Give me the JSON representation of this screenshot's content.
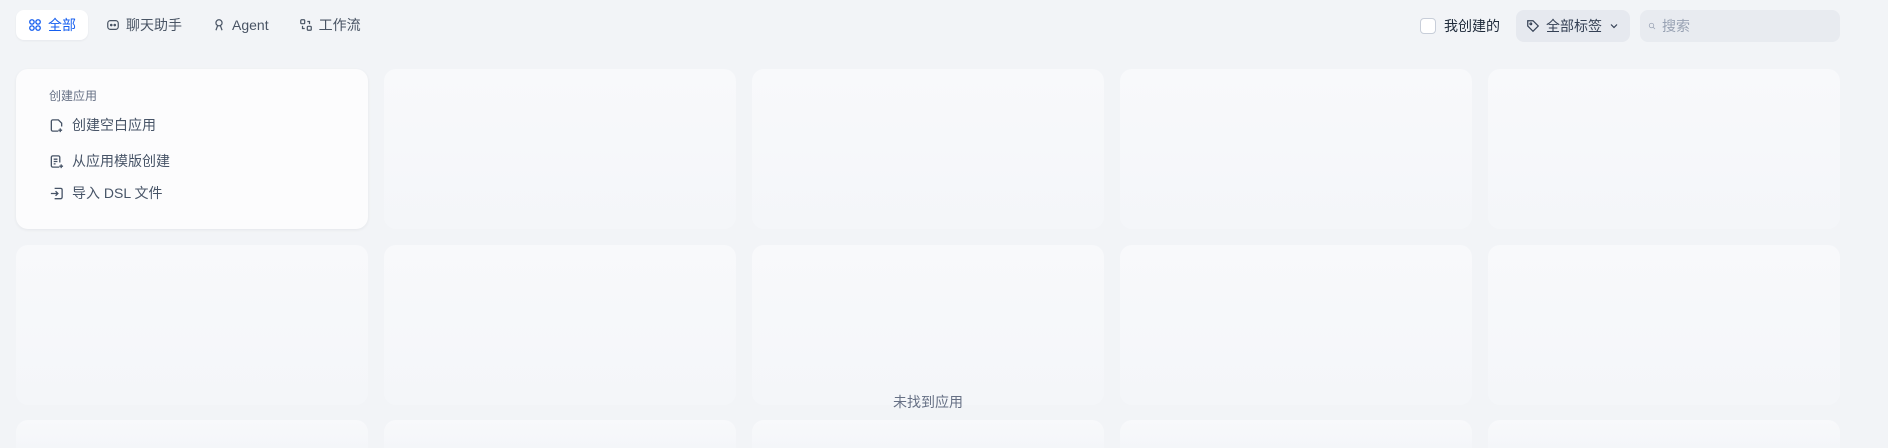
{
  "tabs": [
    {
      "label": "全部",
      "icon": "grid-icon",
      "active": true
    },
    {
      "label": "聊天助手",
      "icon": "chat-bot-icon",
      "active": false
    },
    {
      "label": "Agent",
      "icon": "agent-icon",
      "active": false
    },
    {
      "label": "工作流",
      "icon": "workflow-icon",
      "active": false
    }
  ],
  "filters": {
    "my_created_label": "我创建的",
    "my_created_checked": false,
    "tag_label": "全部标签",
    "search_placeholder": "搜索"
  },
  "create_card": {
    "title": "创建应用",
    "items": [
      {
        "label": "创建空白应用",
        "icon": "file-plus-icon"
      },
      {
        "label": "从应用模版创建",
        "icon": "template-icon"
      },
      {
        "label": "导入 DSL 文件",
        "icon": "import-icon"
      }
    ]
  },
  "empty_text": "未找到应用",
  "colors": {
    "accent": "#155eef",
    "page_bg": "#f2f4f7",
    "card_bg": "#f8f9fb"
  }
}
